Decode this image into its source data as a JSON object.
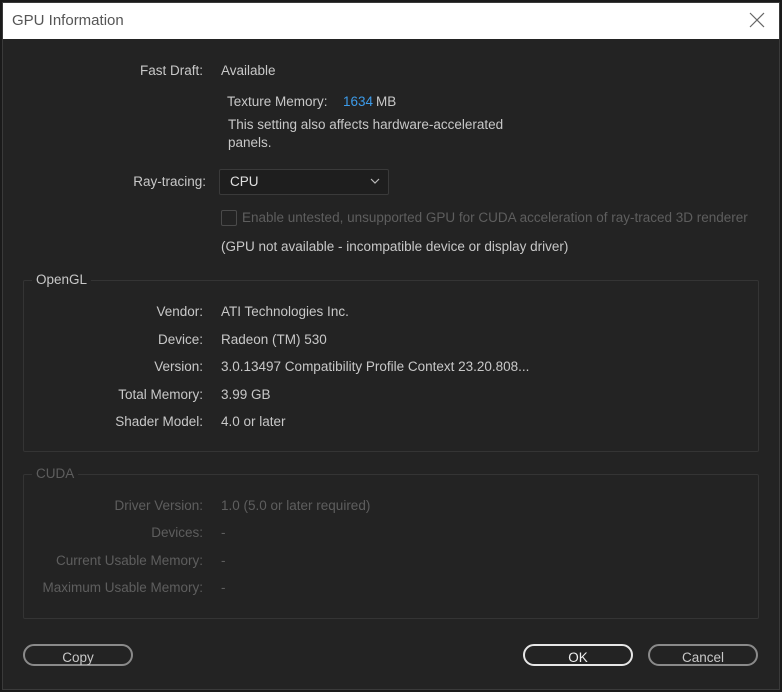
{
  "window": {
    "title": "GPU Information"
  },
  "fast_draft": {
    "label": "Fast Draft:",
    "value": "Available"
  },
  "texture_memory": {
    "label": "Texture Memory:",
    "value": "1634",
    "unit": "MB",
    "note_line1": "This setting also affects hardware-accelerated",
    "note_line2": "panels."
  },
  "ray_tracing": {
    "label": "Ray-tracing:",
    "selected": "CPU"
  },
  "cuda_checkbox": {
    "label": "Enable untested, unsupported GPU for CUDA acceleration of ray-traced 3D renderer",
    "checked": false
  },
  "gpu_status": "(GPU not available - incompatible device or display driver)",
  "opengl": {
    "title": "OpenGL",
    "rows": [
      {
        "label": "Vendor:",
        "value": "ATI Technologies Inc."
      },
      {
        "label": "Device:",
        "value": "Radeon (TM) 530"
      },
      {
        "label": "Version:",
        "value": "3.0.13497 Compatibility Profile Context 23.20.808..."
      },
      {
        "label": "Total Memory:",
        "value": "3.99 GB"
      },
      {
        "label": "Shader Model:",
        "value": "4.0 or later"
      }
    ]
  },
  "cuda": {
    "title": "CUDA",
    "rows": [
      {
        "label": "Driver Version:",
        "value": "1.0 (5.0 or later required)"
      },
      {
        "label": "Devices:",
        "value": "-"
      },
      {
        "label": "Current Usable Memory:",
        "value": "-"
      },
      {
        "label": "Maximum Usable Memory:",
        "value": "-"
      }
    ]
  },
  "buttons": {
    "copy": "Copy",
    "ok": "OK",
    "cancel": "Cancel"
  },
  "colors": {
    "accent": "#3d9be9",
    "background": "#232323"
  }
}
